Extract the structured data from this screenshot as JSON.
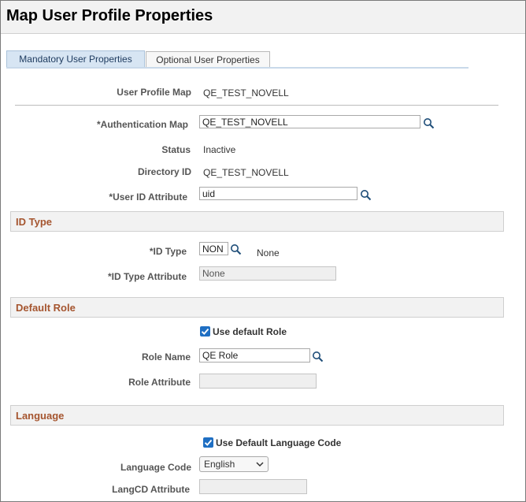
{
  "page": {
    "title": "Map User Profile Properties"
  },
  "tabs": [
    {
      "label": "Mandatory User Properties",
      "active": true
    },
    {
      "label": "Optional User Properties",
      "active": false
    }
  ],
  "header": {
    "user_profile_map_label": "User Profile Map",
    "user_profile_map_value": "QE_TEST_NOVELL"
  },
  "fields": {
    "auth_map_label": "*Authentication Map",
    "auth_map_value": "QE_TEST_NOVELL",
    "status_label": "Status",
    "status_value": "Inactive",
    "directory_id_label": "Directory ID",
    "directory_id_value": "QE_TEST_NOVELL",
    "user_id_attr_label": "*User ID Attribute",
    "user_id_attr_value": "uid"
  },
  "id_type_section": {
    "title": "ID Type",
    "id_type_label": "*ID Type",
    "id_type_value": "NON",
    "id_type_desc": "None",
    "id_type_attr_label": "*ID Type Attribute",
    "id_type_attr_value": "None"
  },
  "default_role_section": {
    "title": "Default Role",
    "use_default_label": "Use default Role",
    "use_default_checked": true,
    "role_name_label": "Role Name",
    "role_name_value": "QE Role",
    "role_attr_label": "Role Attribute",
    "role_attr_value": ""
  },
  "language_section": {
    "title": "Language",
    "use_default_lang_label": "Use Default Language Code",
    "use_default_lang_checked": true,
    "language_code_label": "Language Code",
    "language_code_value": "English",
    "langcd_attr_label": "LangCD Attribute",
    "langcd_attr_value": ""
  },
  "colors": {
    "section_title": "#a5552f",
    "tab_active_bg": "#d7e5f3",
    "checkbox": "#1f6fc3"
  },
  "icons": {
    "lookup": "search-icon",
    "checkbox": "checkmark-icon",
    "select": "chevron-down-icon"
  }
}
